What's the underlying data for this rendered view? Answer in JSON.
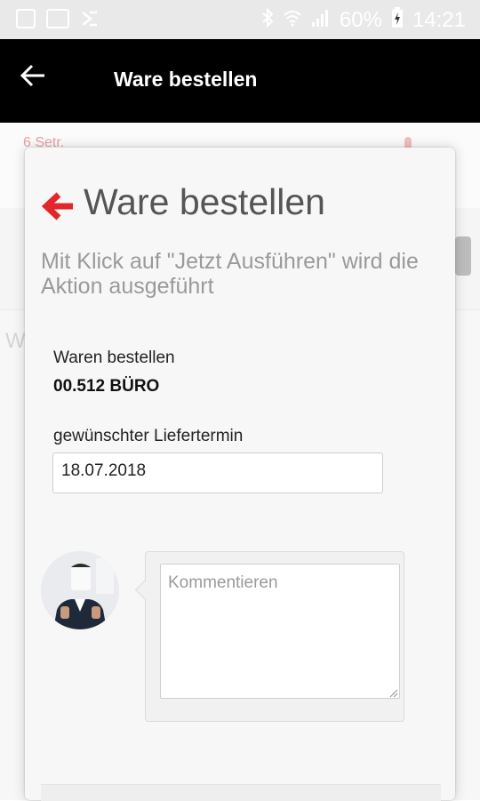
{
  "status_bar": {
    "left_icons": [
      "image-icon",
      "photo-icon",
      "download-check-icon"
    ],
    "right_icons": [
      "bluetooth-icon",
      "wifi-icon",
      "signal-icon",
      "battery-charging-icon"
    ],
    "battery": "60%",
    "time": "14:21"
  },
  "app_bar": {
    "back_icon": "arrow-left-icon",
    "title": "Ware bestellen"
  },
  "background": {
    "row1_text": "6 Setr.",
    "letter": "W"
  },
  "dialog": {
    "back_icon": "red-arrow-left-icon",
    "title": "Ware bestellen",
    "subtitle": "Mit Klick auf \"Jetzt Ausführen\" wird die Aktion ausgeführt",
    "item_label": "Waren bestellen",
    "item_value": "00.512 BÜRO",
    "date_label": "gewünschter Liefertermin",
    "date_value": "18.07.2018",
    "comment_placeholder": "Kommentieren",
    "accent_color": "#e3262b"
  }
}
